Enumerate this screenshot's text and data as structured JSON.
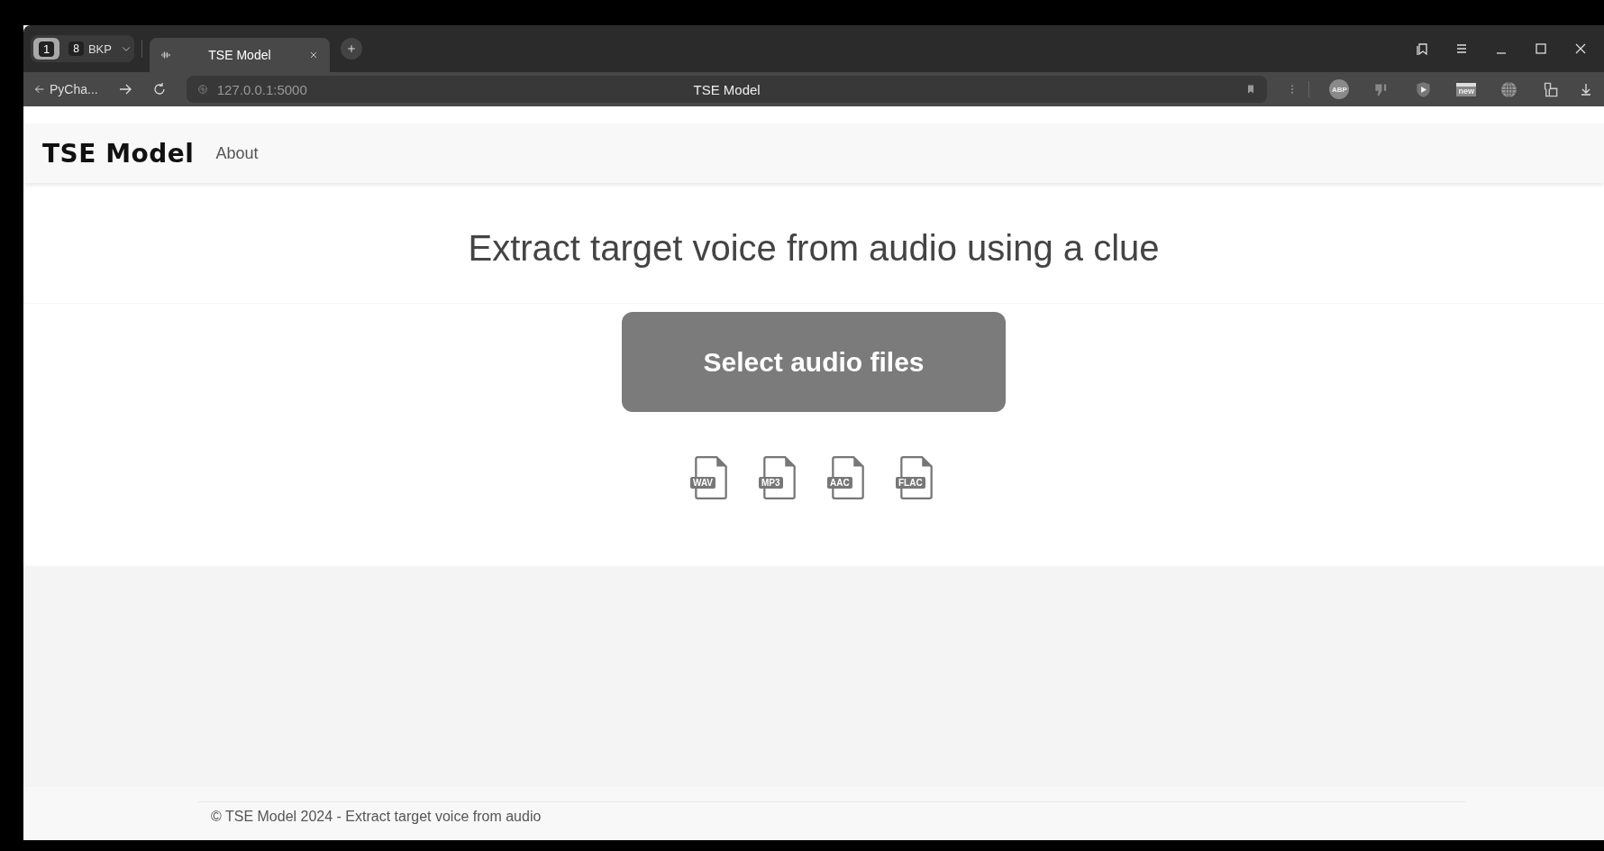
{
  "browser": {
    "tab_groups": [
      {
        "label": "1",
        "selected": true
      },
      {
        "count": "8",
        "label": "BKP",
        "selected": false
      }
    ],
    "tabs": [
      {
        "title": "TSE Model",
        "selected": true
      }
    ],
    "back_label": "PyCha...",
    "url": "127.0.0.1:5000",
    "page_title": "TSE Model",
    "extensions": [
      {
        "kind": "abp",
        "label": "ABP"
      },
      {
        "kind": "thumb"
      },
      {
        "kind": "shield"
      },
      {
        "kind": "new",
        "label": "new"
      },
      {
        "kind": "globe"
      },
      {
        "kind": "tool"
      }
    ]
  },
  "site": {
    "brand": "TSE Model",
    "nav": [
      "About"
    ],
    "heading": "Extract target voice from audio using a clue",
    "button": "Select audio files",
    "formats": [
      "WAV",
      "MP3",
      "AAC",
      "FLAC"
    ],
    "footer": "© TSE Model 2024 - Extract target voice from audio"
  }
}
